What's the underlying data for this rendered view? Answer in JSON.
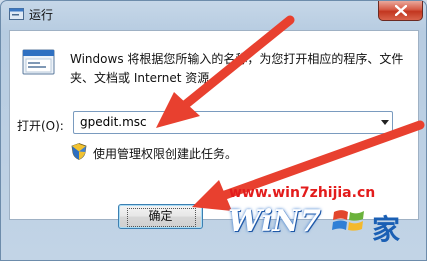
{
  "window": {
    "title": "运行",
    "icon": "run-icon"
  },
  "dialog": {
    "description": "Windows 将根据您所输入的名称，为您打开相应的程序、文件夹、文档或 Internet 资源。",
    "open_label": "打开(O):",
    "open_value": "gpedit.msc",
    "admin_notice": "使用管理权限创建此任务。"
  },
  "buttons": {
    "ok_label": "确定"
  },
  "watermark": {
    "url": "www.win7zhijia.cn",
    "logo_text": "WiN7",
    "logo_suffix": "家"
  },
  "colors": {
    "arrow": "#e8402f",
    "watermark_url": "#e31c1c"
  }
}
